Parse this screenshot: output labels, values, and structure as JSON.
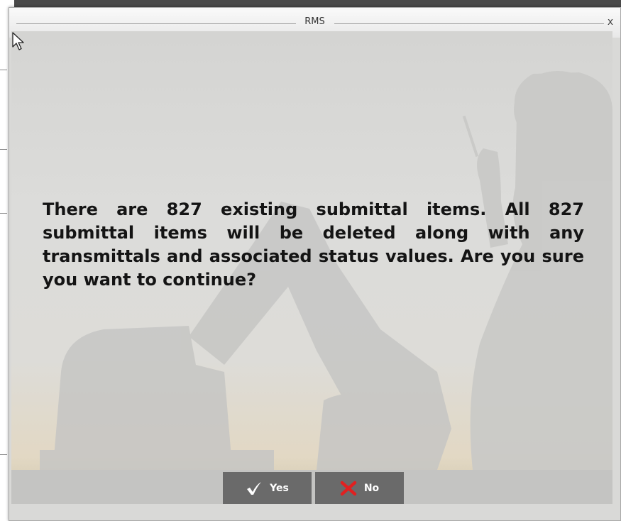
{
  "dialog": {
    "title": "RMS",
    "close_label": "x",
    "message": "There are 827 existing submittal items. All 827 submittal items will be deleted along with any transmittals and associated status values. Are you sure you want to continue?"
  },
  "buttons": {
    "yes_label": "Yes",
    "no_label": "No"
  },
  "icons": {
    "yes": "checkmark-icon",
    "no": "x-icon",
    "close": "close-icon"
  },
  "colors": {
    "yes_check": "#ffffff",
    "no_x": "#e02020",
    "button_bg": "#6a6a6a"
  }
}
